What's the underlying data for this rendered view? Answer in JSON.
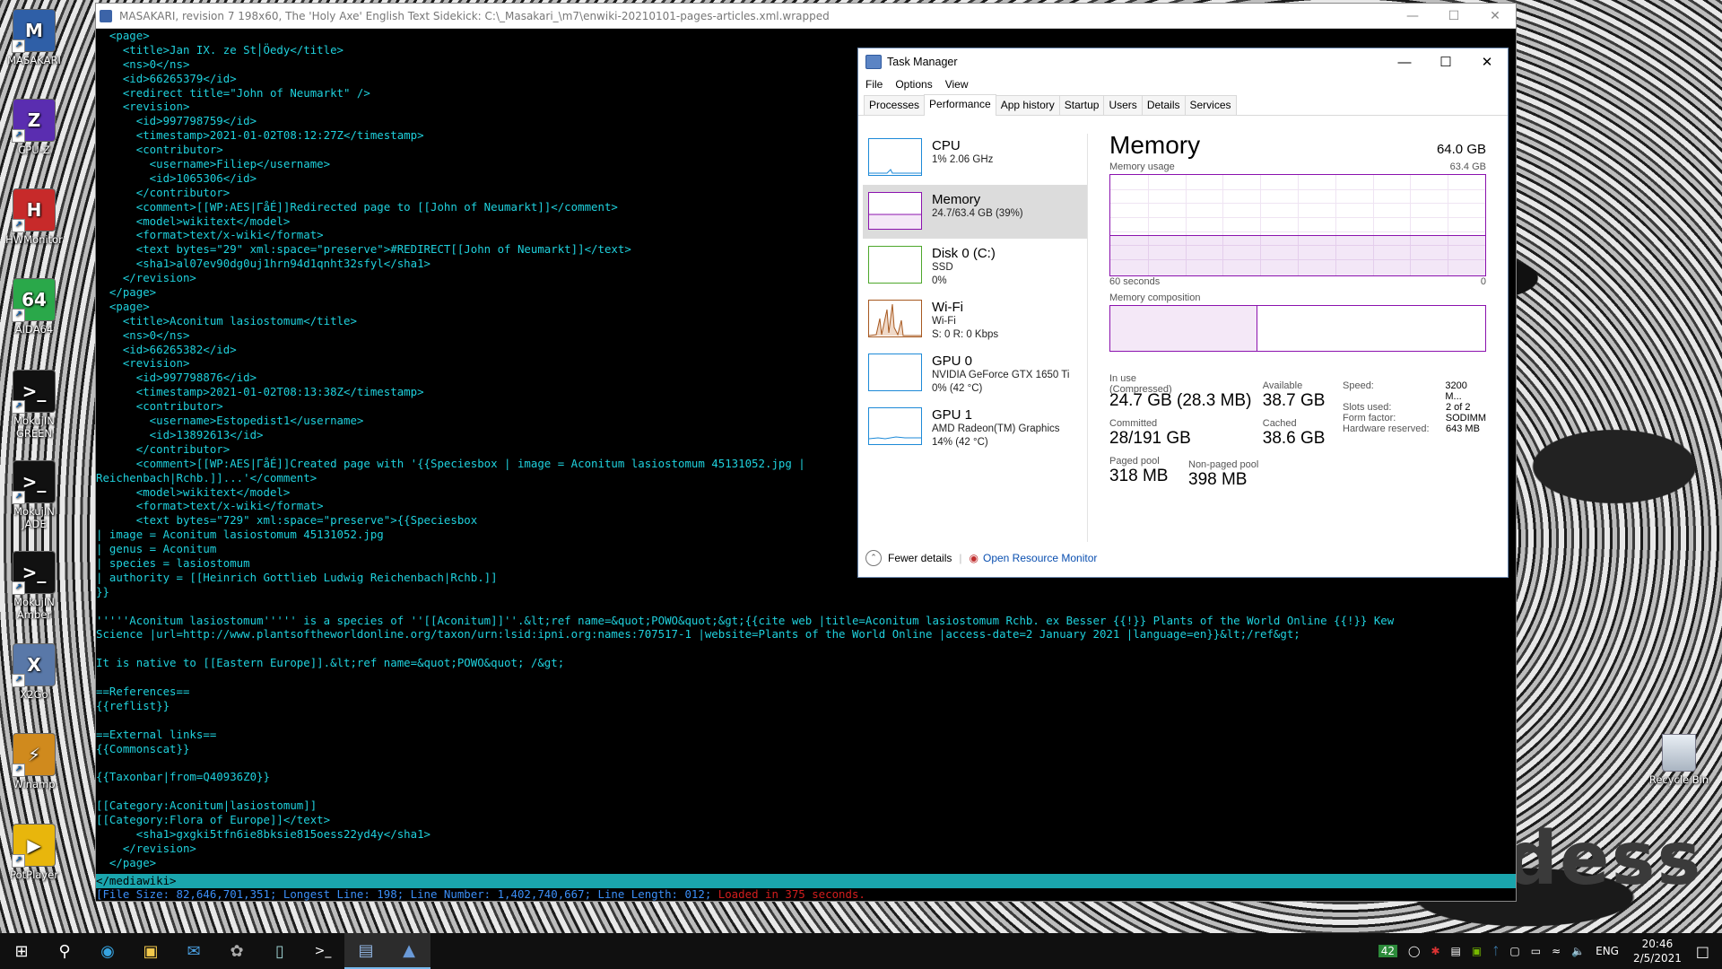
{
  "desktop": {
    "icons": [
      {
        "label": "MASAKARI",
        "icon": "masakari-icon",
        "color": "#2f5fa7",
        "glyph": "M"
      },
      {
        "label": "CPU-Z",
        "icon": "cpuz-icon",
        "color": "#5a2db0",
        "glyph": "Z"
      },
      {
        "label": "HWMonitor",
        "icon": "hwmonitor-icon",
        "color": "#c72a2a",
        "glyph": "H"
      },
      {
        "label": "AIDA64",
        "icon": "aida64-icon",
        "color": "#2aa84a",
        "glyph": "64"
      },
      {
        "label": "MokujIN GREEN",
        "icon": "terminal-icon",
        "color": "#111",
        "glyph": ">_"
      },
      {
        "label": "MokujIN JADE",
        "icon": "terminal-icon",
        "color": "#111",
        "glyph": ">_"
      },
      {
        "label": "MokujIN Amber",
        "icon": "terminal-icon",
        "color": "#111",
        "glyph": ">_"
      },
      {
        "label": "X2Go",
        "icon": "x2go-icon",
        "color": "#5978a8",
        "glyph": "X"
      },
      {
        "label": "Winamp",
        "icon": "winamp-icon",
        "color": "#d08a1d",
        "glyph": "⚡"
      },
      {
        "label": "PotPlayer",
        "icon": "potplayer-icon",
        "color": "#e8b60c",
        "glyph": "▶"
      }
    ],
    "recycle_bin": "Recycle Bin",
    "wallpaper_text": "odess"
  },
  "console": {
    "title": "MASAKARI, revision 7 198x60, The 'Holy Axe' English Text Sidekick: C:\\_Masakari_\\m7\\enwiki-20210101-pages-articles.xml.wrapped",
    "lines": [
      "  <page>",
      "    <title>Jan IX. ze St│Öedy</title>",
      "    <ns>0</ns>",
      "    <id>66265379</id>",
      "    <redirect title=\"John of Neumarkt\" />",
      "    <revision>",
      "      <id>997798759</id>",
      "      <timestamp>2021-01-02T08:12:27Z</timestamp>",
      "      <contributor>",
      "        <username>Filiep</username>",
      "        <id>1065306</id>",
      "      </contributor>",
      "      <comment>[[WP:AES|ΓåÉ]]Redirected page to [[John of Neumarkt]]</comment>",
      "      <model>wikitext</model>",
      "      <format>text/x-wiki</format>",
      "      <text bytes=\"29\" xml:space=\"preserve\">#REDIRECT[[John of Neumarkt]]</text>",
      "      <sha1>al07ev90dg0uj1hrn94d1qnht32sfyl</sha1>",
      "    </revision>",
      "  </page>",
      "  <page>",
      "    <title>Aconitum lasiostomum</title>",
      "    <ns>0</ns>",
      "    <id>66265382</id>",
      "    <revision>",
      "      <id>997798876</id>",
      "      <timestamp>2021-01-02T08:13:38Z</timestamp>",
      "      <contributor>",
      "        <username>Estopedist1</username>",
      "        <id>13892613</id>",
      "      </contributor>",
      "      <comment>[[WP:AES|ΓåÉ]]Created page with '{{Speciesbox | image = Aconitum lasiostomum 45131052.jpg |",
      "Reichenbach|Rchb.]]...'</comment>",
      "      <model>wikitext</model>",
      "      <format>text/x-wiki</format>",
      "      <text bytes=\"729\" xml:space=\"preserve\">{{Speciesbox",
      "| image = Aconitum lasiostomum 45131052.jpg",
      "| genus = Aconitum",
      "| species = lasiostomum",
      "| authority = [[Heinrich Gottlieb Ludwig Reichenbach|Rchb.]]",
      "}}",
      "",
      "'''''Aconitum lasiostomum''''' is a species of ''[[Aconitum]]''.&lt;ref name=&quot;POWO&quot;&gt;{{cite web |title=Aconitum lasiostomum Rchb. ex Besser {{!}} Plants of the World Online {{!}} Kew",
      "Science |url=http://www.plantsoftheworldonline.org/taxon/urn:lsid:ipni.org:names:707517-1 |website=Plants of the World Online |access-date=2 January 2021 |language=en}}&lt;/ref&gt;",
      "",
      "It is native to [[Eastern Europe]].&lt;ref name=&quot;POWO&quot; /&gt;",
      "",
      "==References==",
      "{{reflist}}",
      "",
      "==External links==",
      "{{Commonscat}}",
      "",
      "{{Taxonbar|from=Q40936Z0}}",
      "",
      "[[Category:Aconitum|lasiostomum]]",
      "[[Category:Flora of Europe]]</text>",
      "      <sha1>gxgki5tfn6ie8bksie815oess22yd4y</sha1>",
      "    </revision>",
      "  </page>"
    ],
    "highlight_line": "</mediawiki>",
    "status_line": "[File Size: 82,646,701,351; Longest Line: 198; Line Number: 1,402,740,667; Line Length: 012; ",
    "status_loaded": "Loaded in 375 seconds."
  },
  "taskmanager": {
    "title": "Task Manager",
    "menu": [
      "File",
      "Options",
      "View"
    ],
    "tabs": [
      "Processes",
      "Performance",
      "App history",
      "Startup",
      "Users",
      "Details",
      "Services"
    ],
    "active_tab": "Performance",
    "left_items": [
      {
        "name": "CPU",
        "sub1": "1% 2.06 GHz",
        "sub2": "",
        "sub3": ""
      },
      {
        "name": "Memory",
        "sub1": "24.7/63.4 GB (39%)",
        "sub2": "",
        "sub3": ""
      },
      {
        "name": "Disk 0 (C:)",
        "sub1": "SSD",
        "sub2": "0%",
        "sub3": ""
      },
      {
        "name": "Wi-Fi",
        "sub1": "Wi-Fi",
        "sub2": "S: 0 R: 0 Kbps",
        "sub3": ""
      },
      {
        "name": "GPU 0",
        "sub1": "NVIDIA GeForce GTX 1650 Ti",
        "sub2": "0% (42 °C)",
        "sub3": ""
      },
      {
        "name": "GPU 1",
        "sub1": "AMD Radeon(TM) Graphics",
        "sub2": "14% (42 °C)",
        "sub3": ""
      }
    ],
    "memory": {
      "title": "Memory",
      "total": "64.0 GB",
      "usage_label": "Memory usage",
      "usage_max": "63.4 GB",
      "time_left": "60 seconds",
      "time_right": "0",
      "usage_fraction": 0.39,
      "composition_label": "Memory composition",
      "composition_fraction": 0.39,
      "in_use_label": "In use (Compressed)",
      "in_use_value": "24.7 GB (28.3 MB)",
      "available_label": "Available",
      "available_value": "38.7 GB",
      "committed_label": "Committed",
      "committed_value": "28/191 GB",
      "cached_label": "Cached",
      "cached_value": "38.6 GB",
      "paged_label": "Paged pool",
      "paged_value": "318 MB",
      "nonpaged_label": "Non-paged pool",
      "nonpaged_value": "398 MB",
      "speed_label": "Speed:",
      "speed_value": "3200 M...",
      "slots_label": "Slots used:",
      "slots_value": "2 of 2",
      "form_label": "Form factor:",
      "form_value": "SODIMM",
      "reserved_label": "Hardware reserved:",
      "reserved_value": "643 MB"
    },
    "fewer_details": "Fewer details",
    "open_monitor": "Open Resource Monitor"
  },
  "taskbar": {
    "lang": "ENG",
    "time": "20:46",
    "date": "2/5/2021",
    "tray_badge": "42"
  }
}
